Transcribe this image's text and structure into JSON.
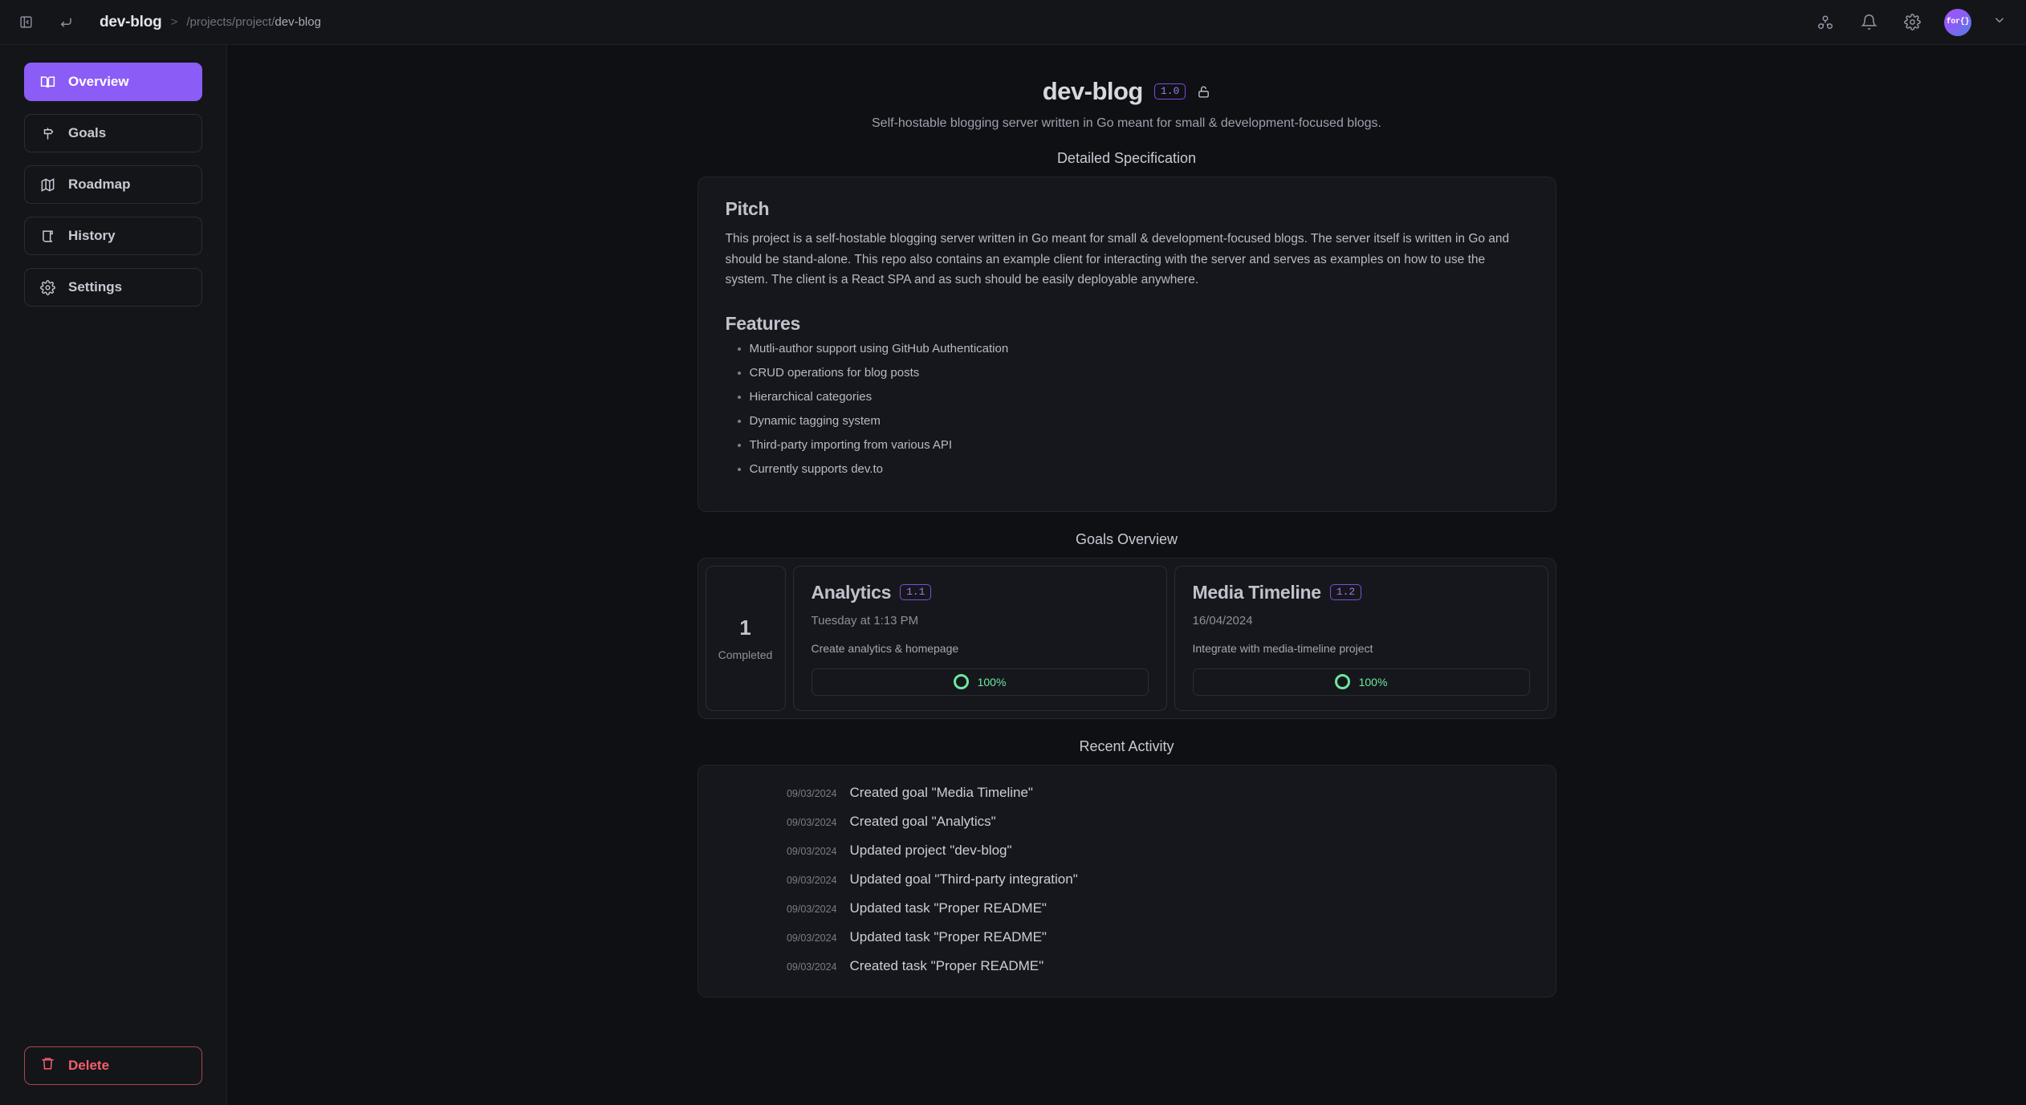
{
  "topbar": {
    "panel_toggle_icon": "panel-collapse-icon",
    "back_icon": "return-arrow-icon",
    "breadcrumb_title": "dev-blog",
    "breadcrumb_sep": ">",
    "breadcrumb_path_prefix": "/projects/project/",
    "breadcrumb_path_current": "dev-blog",
    "icons": [
      "molecule-icon",
      "bell-icon",
      "gear-icon"
    ],
    "avatar_label": "for{}",
    "chevron_icon": "chevron-down-icon"
  },
  "sidebar": {
    "items": [
      {
        "label": "Overview",
        "icon": "book-open-icon",
        "active": true
      },
      {
        "label": "Goals",
        "icon": "signpost-icon",
        "active": false
      },
      {
        "label": "Roadmap",
        "icon": "map-icon",
        "active": false
      },
      {
        "label": "History",
        "icon": "scroll-icon",
        "active": false
      },
      {
        "label": "Settings",
        "icon": "gear-icon",
        "active": false
      }
    ],
    "delete_label": "Delete",
    "delete_icon": "trash-icon"
  },
  "page": {
    "title": "dev-blog",
    "version_badge": "1.0",
    "lock_icon": "unlock-icon",
    "subtitle": "Self-hostable blogging server written in Go meant for small & development-focused blogs."
  },
  "spec": {
    "section_title": "Detailed Specification",
    "pitch_heading": "Pitch",
    "pitch_body": "This project is a self-hostable blogging server written in Go meant for small & development-focused blogs. The server itself is written in Go and should be stand-alone. This repo also contains an example client for interacting with the server and serves as examples on how to use the system. The client is a React SPA and as such should be easily deployable anywhere.",
    "features_heading": "Features",
    "features": [
      "Mutli-author support using GitHub Authentication",
      "CRUD operations for blog posts",
      "Hierarchical categories",
      "Dynamic tagging system",
      "Third-party importing from various API",
      "Currently supports dev.to"
    ]
  },
  "goals": {
    "section_title": "Goals Overview",
    "stat_number": "1",
    "stat_label": "Completed",
    "cards": [
      {
        "name": "Analytics",
        "badge": "1.1",
        "date": "Tuesday at 1:13 PM",
        "description": "Create analytics & homepage",
        "progress": "100%"
      },
      {
        "name": "Media Timeline",
        "badge": "1.2",
        "date": "16/04/2024",
        "description": "Integrate with media-timeline project",
        "progress": "100%"
      }
    ]
  },
  "activity": {
    "section_title": "Recent Activity",
    "rows": [
      {
        "date": "09/03/2024",
        "text": "Created goal \"Media Timeline\""
      },
      {
        "date": "09/03/2024",
        "text": "Created goal \"Analytics\""
      },
      {
        "date": "09/03/2024",
        "text": "Updated project \"dev-blog\""
      },
      {
        "date": "09/03/2024",
        "text": "Updated goal \"Third-party integration\""
      },
      {
        "date": "09/03/2024",
        "text": "Updated task \"Proper README\""
      },
      {
        "date": "09/03/2024",
        "text": "Updated task \"Proper README\""
      },
      {
        "date": "09/03/2024",
        "text": "Created task \"Proper README\""
      }
    ]
  },
  "colors": {
    "accent_purple": "#8b5cf6",
    "badge_purple": "#9f7aea",
    "danger_red": "#f0606a",
    "success_green": "#6ee7a0",
    "background": "#0f1014",
    "panel": "#141519",
    "card": "#16171c"
  }
}
